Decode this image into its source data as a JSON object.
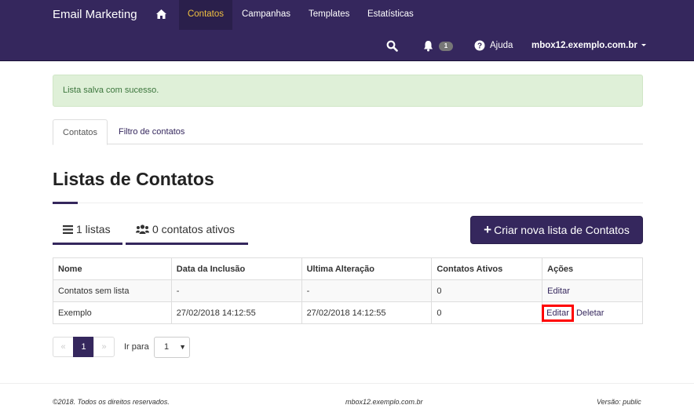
{
  "navbar": {
    "brand": "Email Marketing",
    "home_icon": "home-icon",
    "items": [
      {
        "label": "Contatos",
        "active": true
      },
      {
        "label": "Campanhas",
        "active": false
      },
      {
        "label": "Templates",
        "active": false
      },
      {
        "label": "Estatísticas",
        "active": false
      }
    ],
    "search_icon": "search-icon",
    "bell_icon": "bell-icon",
    "notification_count": "1",
    "help_icon": "question-circle-icon",
    "help_label": "Ajuda",
    "user": "mbox12.exemplo.com.br",
    "colors": {
      "background": "#35275d",
      "active_bg": "#2a1f4b",
      "active_text": "#f0c040"
    }
  },
  "alert": {
    "message": "Lista salva com sucesso.",
    "type": "success"
  },
  "tabs": [
    {
      "label": "Contatos",
      "active": true
    },
    {
      "label": "Filtro de contatos",
      "active": false
    }
  ],
  "page": {
    "title": "Listas de Contatos",
    "stats": {
      "lists": "1 listas",
      "lists_icon": "list-icon",
      "contacts": "0 contatos ativos",
      "contacts_icon": "users-icon"
    },
    "create_button": "Criar nova lista de Contatos"
  },
  "table": {
    "headers": [
      "Nome",
      "Data da Inclusão",
      "Ultima Alteração",
      "Contatos Ativos",
      "Ações"
    ],
    "rows": [
      {
        "name": "Contatos sem lista",
        "created": "-",
        "modified": "-",
        "active": "0",
        "actions": [
          "Editar"
        ]
      },
      {
        "name": "Exemplo",
        "created": "27/02/2018 14:12:55",
        "modified": "27/02/2018 14:12:55",
        "active": "0",
        "actions": [
          "Editar",
          "Deletar"
        ]
      }
    ]
  },
  "pagination": {
    "prev": "«",
    "current": "1",
    "next": "»",
    "goto_label": "Ir para",
    "goto_value": "1",
    "goto_arrow": "▼"
  },
  "footer": {
    "copyright": "©2018. Todos os direitos reservados.",
    "host": "mbox12.exemplo.com.br",
    "version": "Versão: public"
  }
}
